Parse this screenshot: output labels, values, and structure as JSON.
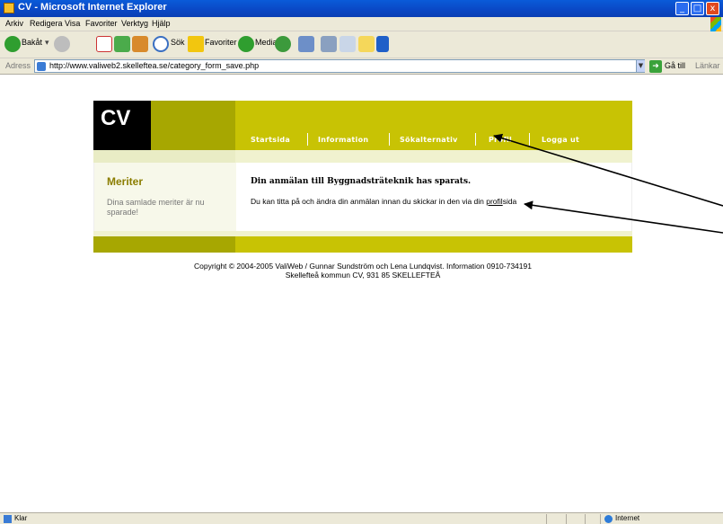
{
  "window": {
    "title": "CV - Microsoft Internet Explorer",
    "minimize": "_",
    "maximize": "□",
    "close": "x"
  },
  "menu": [
    "Arkiv",
    "Redigera",
    "Visa",
    "Favoriter",
    "Verktyg",
    "Hjälp"
  ],
  "toolbar": {
    "back_label": "Bakåt",
    "search_label": "Sök",
    "favorites_label": "Favoriter",
    "media_label": "Media"
  },
  "address": {
    "label": "Adress",
    "url": "http://www.valiweb2.skelleftea.se/category_form_save.php",
    "go_label": "Gå till",
    "links_label": "Länkar"
  },
  "site": {
    "logo": "CV",
    "nav": [
      "Startsida",
      "Information",
      "Sökalternativ",
      "Profil",
      "Logga ut"
    ],
    "sidebar_title": "Meriter",
    "sidebar_text": "Dina samlade meriter är nu sparade!",
    "heading": "Din anmälan till Byggnadsträteknik has sparats.",
    "message_before": "Du kan titta på och ändra din anmälan innan du skickar in den via din ",
    "message_link": "profil",
    "message_after": "sida",
    "copyright_line1": "Copyright © 2004-2005 ValiWeb / Gunnar Sundström och Lena Lundqvist. Information 0910-734191",
    "copyright_line2": "Skellefteå kommun CV,  931 85 SKELLEFTEÅ"
  },
  "status": {
    "text": "Klar",
    "zone": "Internet"
  },
  "colors": {
    "olive_dark": "#a7a701",
    "olive": "#c8c304",
    "sidebar_title": "#8b7d00"
  }
}
